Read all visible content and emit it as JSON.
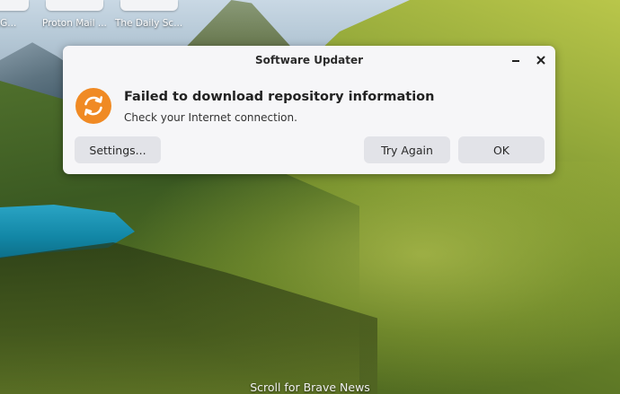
{
  "desktop": {
    "shortcuts": [
      {
        "label": "uckG...",
        "icon": "app-tile"
      },
      {
        "label": "Proton Mail ...",
        "icon": "app-tile"
      },
      {
        "label": "The Daily Sc...",
        "icon": "app-tile"
      }
    ],
    "scroll_hint": "Scroll for Brave News"
  },
  "dialog": {
    "title": "Software Updater",
    "minimize_icon": "minimize-icon",
    "close_icon": "close-icon",
    "message_title": "Failed to download repository information",
    "message_subtitle": "Check your Internet connection.",
    "icon": "update-refresh-icon",
    "icon_color": "#f08a24",
    "buttons": {
      "settings": "Settings...",
      "try_again": "Try Again",
      "ok": "OK"
    }
  }
}
